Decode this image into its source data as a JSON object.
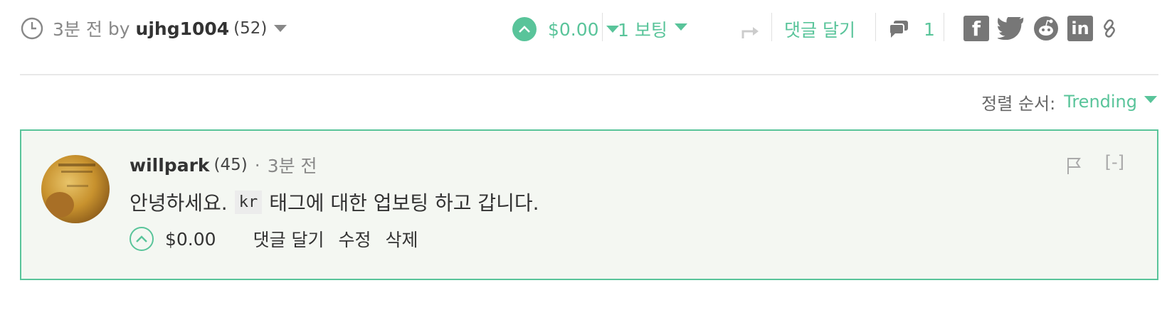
{
  "post_footer": {
    "time_ago": "3분 전",
    "by_label": "by",
    "author": "ujhg1004",
    "reputation": "(52)",
    "payout": "$0.00",
    "votes_label": "1 보팅",
    "reply_label": "댓글 달기",
    "comment_count": "1",
    "share_icons": [
      "facebook-icon",
      "twitter-icon",
      "reddit-icon",
      "linkedin-icon",
      "link-icon"
    ]
  },
  "sort": {
    "label": "정렬 순서:",
    "value": "Trending"
  },
  "comment": {
    "author": "willpark",
    "reputation": "(45)",
    "dot": "·",
    "time_ago": "3분 전",
    "body_before": "안녕하세요.",
    "body_code": "kr",
    "body_after": "태그에 대한 업보팅 하고 갑니다.",
    "payout": "$0.00",
    "actions": {
      "reply": "댓글 달기",
      "edit": "수정",
      "delete": "삭제"
    },
    "collapse_label": "[-]"
  },
  "colors": {
    "accent": "#59c49a",
    "comment_bg": "#f4f7f2"
  }
}
